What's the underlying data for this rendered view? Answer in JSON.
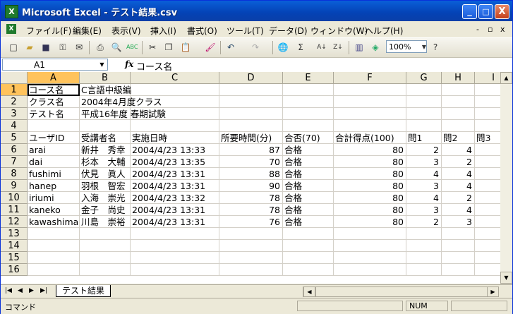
{
  "window": {
    "title": "Microsoft Excel - テスト結果.csv",
    "icon": "excel-icon"
  },
  "window_controls": {
    "minimize": "_",
    "maximize": "□",
    "close": "X"
  },
  "menu": {
    "items": [
      "ファイル(F)",
      "編集(E)",
      "表示(V)",
      "挿入(I)",
      "書式(O)",
      "ツール(T)",
      "データ(D)",
      "ウィンドウ(W)",
      "ヘルプ(H)"
    ],
    "doc_controls": [
      "-",
      "▫",
      "x"
    ]
  },
  "toolbar": {
    "zoom": "100%",
    "font_size_hint": ""
  },
  "formula_bar": {
    "name_box": "A1",
    "fx": "fx",
    "value": "コース名"
  },
  "columns": [
    "A",
    "B",
    "C",
    "D",
    "E",
    "F",
    "G",
    "H",
    "I"
  ],
  "rows": [
    "1",
    "2",
    "3",
    "4",
    "5",
    "6",
    "7",
    "8",
    "9",
    "10",
    "11",
    "12",
    "13",
    "14",
    "15",
    "16"
  ],
  "cells": [
    [
      "コース名",
      "C言語中級編",
      "",
      "",
      "",
      "",
      "",
      "",
      ""
    ],
    [
      "クラス名",
      "2004年4月度クラス",
      "",
      "",
      "",
      "",
      "",
      "",
      ""
    ],
    [
      "テスト名",
      "平成16年度 春期試験",
      "",
      "",
      "",
      "",
      "",
      "",
      ""
    ],
    [
      "",
      "",
      "",
      "",
      "",
      "",
      "",
      "",
      ""
    ],
    [
      "ユーザID",
      "受講者名",
      "実施日時",
      "所要時間(分)",
      "合否(70)",
      "合計得点(100)",
      "問1",
      "問2",
      "問3"
    ],
    [
      "arai",
      "新井　秀幸",
      "2004/4/23 13:33",
      "87",
      "合格",
      "80",
      "2",
      "4",
      ""
    ],
    [
      "dai",
      "杉本　大輔",
      "2004/4/23 13:35",
      "70",
      "合格",
      "80",
      "3",
      "2",
      ""
    ],
    [
      "fushimi",
      "伏見　眞人",
      "2004/4/23 13:31",
      "88",
      "合格",
      "80",
      "4",
      "4",
      ""
    ],
    [
      "hanep",
      "羽根　智宏",
      "2004/4/23 13:31",
      "90",
      "合格",
      "80",
      "3",
      "4",
      ""
    ],
    [
      "iriumi",
      "入海　崇光",
      "2004/4/23 13:32",
      "78",
      "合格",
      "80",
      "4",
      "2",
      ""
    ],
    [
      "kaneko",
      "金子　尚史",
      "2004/4/23 13:31",
      "78",
      "合格",
      "80",
      "3",
      "4",
      ""
    ],
    [
      "kawashima",
      "川島　崇裕",
      "2004/4/23 13:31",
      "76",
      "合格",
      "80",
      "2",
      "3",
      ""
    ],
    [
      "",
      "",
      "",
      "",
      "",
      "",
      "",
      "",
      ""
    ],
    [
      "",
      "",
      "",
      "",
      "",
      "",
      "",
      "",
      ""
    ],
    [
      "",
      "",
      "",
      "",
      "",
      "",
      "",
      "",
      ""
    ],
    [
      "",
      "",
      "",
      "",
      "",
      "",
      "",
      "",
      ""
    ]
  ],
  "sheet_tabs": [
    "テスト結果"
  ],
  "status": {
    "mode": "コマンド",
    "num": "NUM"
  }
}
